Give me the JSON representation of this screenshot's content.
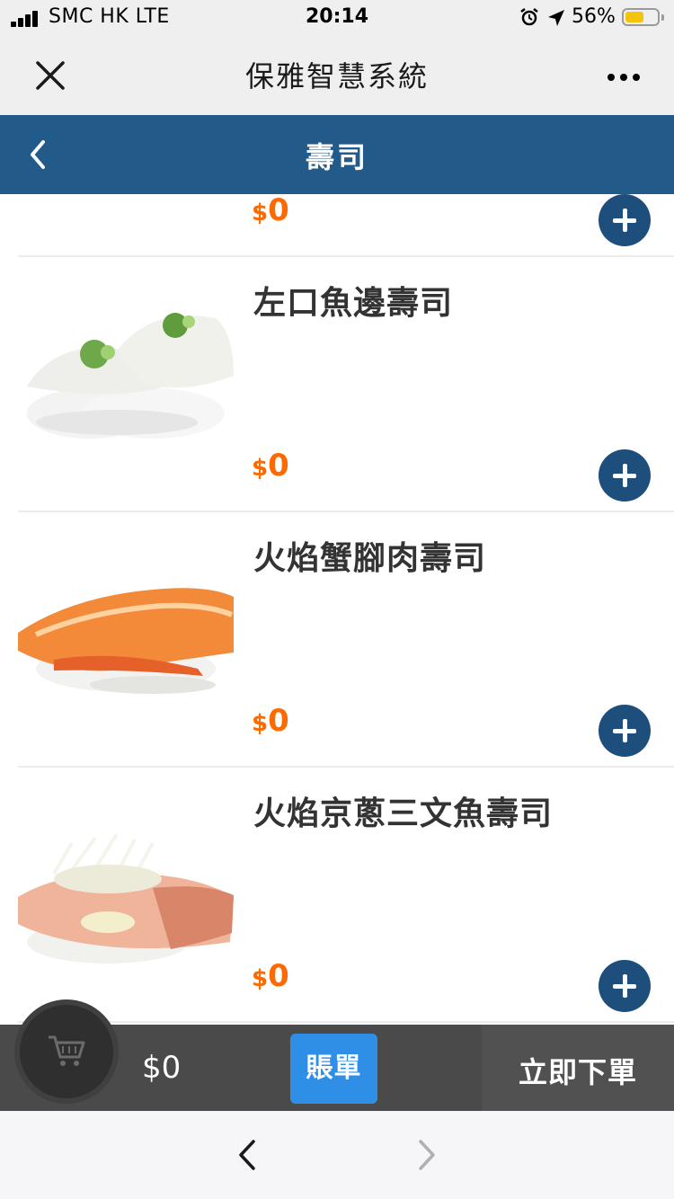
{
  "status_bar": {
    "carrier": "SMC HK  LTE",
    "time": "20:14",
    "battery_percent": "56%"
  },
  "wechat_bar": {
    "title": "保雅智慧系統"
  },
  "header": {
    "title": "壽司"
  },
  "menu_items": [
    {
      "name": "",
      "currency": "$",
      "price": "0"
    },
    {
      "name": "左口魚邊壽司",
      "currency": "$",
      "price": "0"
    },
    {
      "name": "火焰蟹腳肉壽司",
      "currency": "$",
      "price": "0"
    },
    {
      "name": "火焰京蔥三文魚壽司",
      "currency": "$",
      "price": "0"
    }
  ],
  "cart_bar": {
    "total": "$0",
    "bill_label": "賬單",
    "order_label": "立即下單"
  },
  "colors": {
    "header_blue": "#225a8a",
    "add_button": "#1e4f7c",
    "price_orange": "#ff6a00",
    "bill_button": "#2f8fe6",
    "cart_bar": "#4a4a4a"
  }
}
